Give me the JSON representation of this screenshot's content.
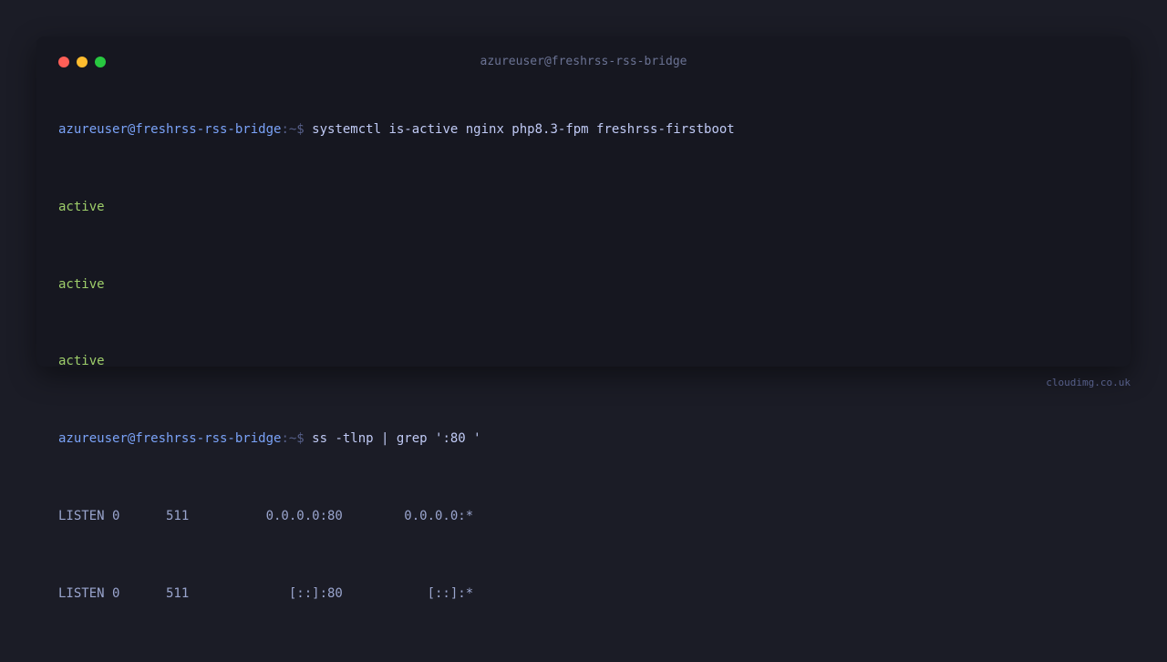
{
  "window": {
    "title": "azureuser@freshrss-rss-bridge"
  },
  "terminal": {
    "prompt_user": "azureuser@freshrss-rss-bridge",
    "prompt_sep": ":~$ ",
    "commands": [
      "systemctl is-active nginx php8.3-fpm freshrss-firstboot",
      "ss -tlnp | grep ':80 '"
    ],
    "outputs": {
      "active_1": "active",
      "active_2": "active",
      "active_3": "active",
      "listen_1": "LISTEN 0      511          0.0.0.0:80        0.0.0.0:*",
      "listen_2": "LISTEN 0      511             [::]:80           [::]:*"
    }
  },
  "footer": {
    "brand": "cloudimg.co.uk"
  },
  "colors": {
    "background": "#1b1c26",
    "terminal_bg": "#161720",
    "prompt_user": "#7aa2f7",
    "command": "#c0caf5",
    "active": "#9ece6a",
    "output": "#9aa5ce",
    "close": "#ff5f57",
    "minimize": "#febc2e",
    "maximize": "#28c840"
  }
}
